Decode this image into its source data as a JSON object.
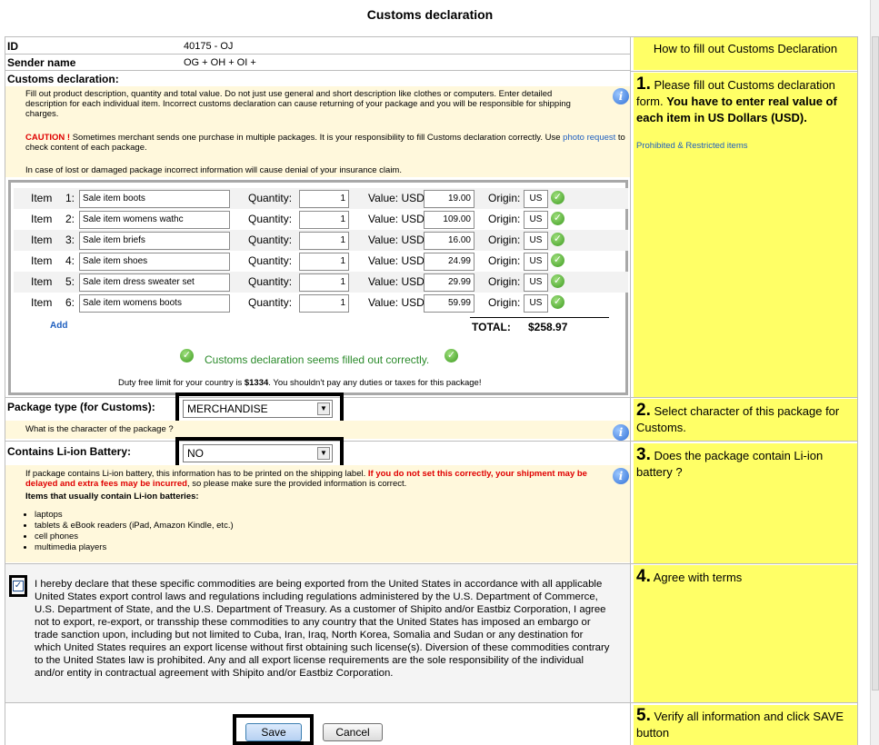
{
  "page_title": "Customs declaration",
  "header": {
    "id_label": "ID",
    "id_value": "40175 - OJ",
    "sender_label": "Sender name",
    "sender_value": "OG + OH + OI +"
  },
  "customs": {
    "section_label": "Customs declaration:",
    "intro": "Fill out product description, quantity and total value. Do not just use general and short description like clothes or computers. Enter detailed description for each individual item. Incorrect customs declaration can cause returning of your package and you will be responsible for shipping charges.",
    "caution_label": "CAUTION !",
    "caution_text": " Sometimes merchant sends one purchase in multiple packages. It is your responsibility to fill Customs declaration correctly. Use ",
    "photo_link": "photo request",
    "caution_tail": " to check content of each package.",
    "insurance_note": "In case of lost or damaged package incorrect information will cause denial of your insurance claim."
  },
  "items_table": {
    "item_label": "Item",
    "quantity_label": "Quantity:",
    "value_label": "Value: USD",
    "origin_label": "Origin:",
    "rows": [
      {
        "num": "1:",
        "desc": "Sale item boots",
        "qty": "1",
        "value": "19.00",
        "origin": "US"
      },
      {
        "num": "2:",
        "desc": "Sale item womens wathc",
        "qty": "1",
        "value": "109.00",
        "origin": "US"
      },
      {
        "num": "3:",
        "desc": "Sale item briefs",
        "qty": "1",
        "value": "16.00",
        "origin": "US"
      },
      {
        "num": "4:",
        "desc": "Sale item shoes",
        "qty": "1",
        "value": "24.99",
        "origin": "US"
      },
      {
        "num": "5:",
        "desc": "Sale item dress   sweater set",
        "qty": "1",
        "value": "29.99",
        "origin": "US"
      },
      {
        "num": "6:",
        "desc": "Sale item womens boots",
        "qty": "1",
        "value": "59.99",
        "origin": "US"
      }
    ],
    "add_link": "Add",
    "total_label": "TOTAL:",
    "total_value": "$258.97",
    "status_text": "Customs declaration seems filled out correctly.",
    "duty_pre": "Duty free limit for your country is ",
    "duty_amount": "$1334",
    "duty_post": ". You shouldn't pay any duties or taxes for this package!"
  },
  "package_type": {
    "label": "Package type (for Customs):",
    "selected": "MERCHANDISE",
    "hint": "What is the character of the package ?"
  },
  "battery": {
    "label": "Contains Li-ion Battery:",
    "selected": "NO",
    "note_pre": "If package contains Li-ion battery, this information has to be printed on the shipping label. ",
    "note_red": "If you do not set this correctly, your shipment may be delayed and extra fees may be incurred",
    "note_post": ", so please make sure the provided information is correct.",
    "items_heading": "Items that usually contain Li-ion batteries:",
    "items": [
      "laptops",
      "tablets & eBook readers (iPad, Amazon Kindle, etc.)",
      "cell phones",
      "multimedia players"
    ]
  },
  "declaration": {
    "checked": true,
    "text": "I hereby declare that these specific commodities are being exported from the United States in accordance with all applicable United States export control laws and regulations including regulations administered by the U.S. Department of Commerce, U.S. Department of State, and the U.S. Department of Treasury. As a customer of Shipito and/or Eastbiz Corporation, I agree not to export, re-export, or transship these commodities to any country that the United States has imposed an embargo or trade sanction upon, including but not limited to Cuba, Iran, Iraq, North Korea, Somalia and Sudan or any destination for which United States requires an export license without first obtaining such license(s). Diversion of these commodities contrary to the United States law is prohibited. Any and all export license requirements are the sole responsibility of the individual and/or entity in contractual agreement with Shipito and/or Eastbiz Corporation."
  },
  "buttons": {
    "save": "Save",
    "cancel": "Cancel"
  },
  "help": {
    "heading": "How to fill out Customs Declaration",
    "step1_num": "1.",
    "step1_text": " Please fill out Customs declaration form. ",
    "step1_bold": "You have to enter real value of each item in US Dollars (USD).",
    "prohibited_link": "Prohibited & Restricted items",
    "step2_num": "2.",
    "step2_text": " Select character of this package for Customs.",
    "step3_num": "3.",
    "step3_text": " Does the package contain Li-ion battery ?",
    "step4_num": "4.",
    "step4_text": " Agree with terms",
    "step5_num": "5.",
    "step5_text": " Verify all information and click SAVE button"
  },
  "colors": {
    "help_bg": "#ffff66",
    "note_bg": "#fff8dc",
    "caution_red": "#e00000",
    "link_blue": "#1f5fbf",
    "ok_green": "#2a8a2a"
  }
}
